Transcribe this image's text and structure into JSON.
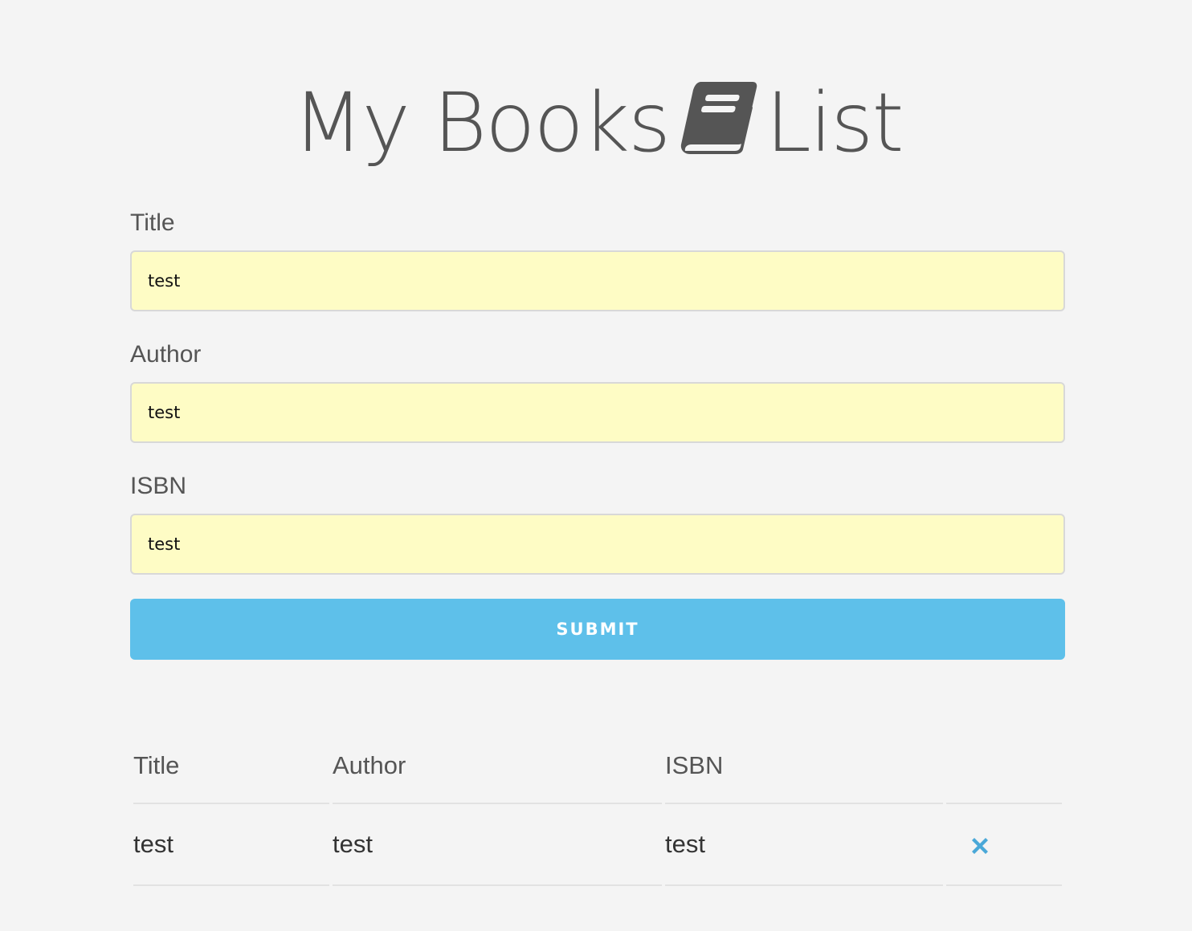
{
  "header": {
    "title_before": "My Books",
    "title_after": "List",
    "icon": "book-icon"
  },
  "form": {
    "title": {
      "label": "Title",
      "value": "test"
    },
    "author": {
      "label": "Author",
      "value": "test"
    },
    "isbn": {
      "label": "ISBN",
      "value": "test"
    },
    "submit_label": "SUBMIT"
  },
  "table": {
    "headers": [
      "Title",
      "Author",
      "ISBN",
      ""
    ],
    "rows": [
      {
        "title": "test",
        "author": "test",
        "isbn": "test",
        "delete_icon": "close-icon"
      }
    ]
  },
  "colors": {
    "background": "#f4f4f4",
    "text": "#555555",
    "input_fill": "#fefcc5",
    "accent": "#5ec0ea",
    "delete": "#4aa8d8"
  }
}
